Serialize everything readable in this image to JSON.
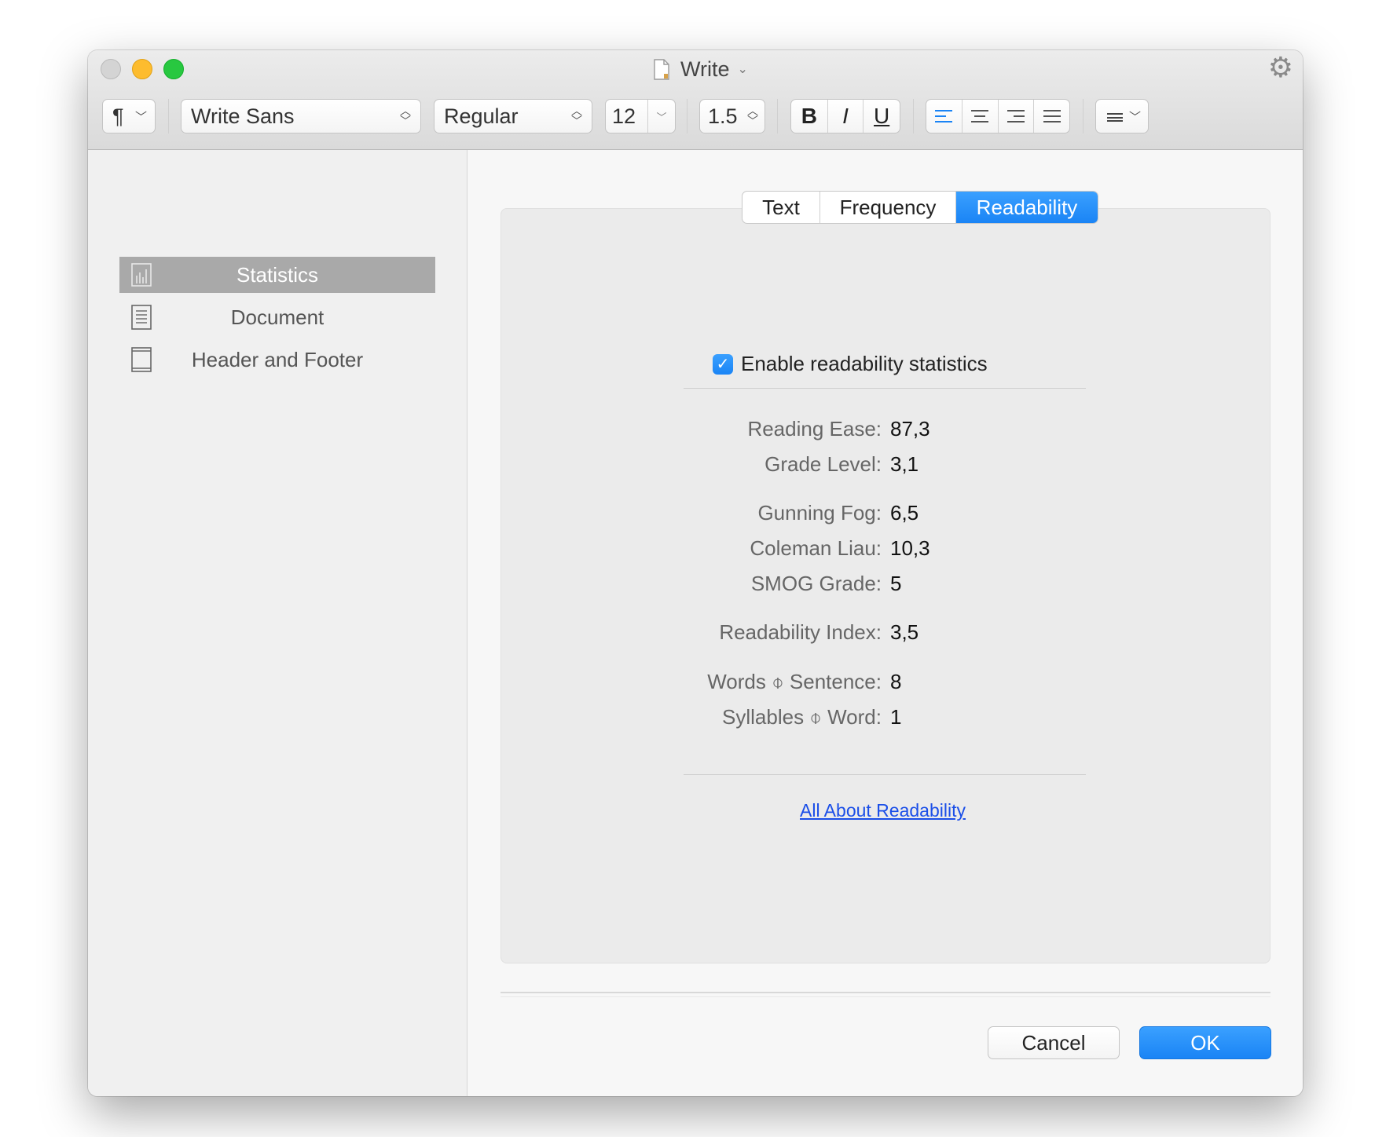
{
  "window": {
    "title": "Write"
  },
  "toolbar": {
    "paragraph_symbol": "¶",
    "font_family": "Write Sans",
    "font_style": "Regular",
    "font_size": "12",
    "line_spacing": "1.5",
    "bold": "B",
    "italic": "I",
    "underline": "U"
  },
  "sidebar": {
    "items": [
      {
        "label": "Statistics",
        "icon": "bar-chart-icon",
        "selected": true
      },
      {
        "label": "Document",
        "icon": "document-icon",
        "selected": false
      },
      {
        "label": "Header and Footer",
        "icon": "page-icon",
        "selected": false
      }
    ]
  },
  "tabs": [
    {
      "label": "Text",
      "active": false
    },
    {
      "label": "Frequency",
      "active": false
    },
    {
      "label": "Readability",
      "active": true
    }
  ],
  "readability": {
    "enable_label": "Enable readability statistics",
    "enabled": true,
    "stats": [
      {
        "label": "Reading Ease:",
        "value": "87,3"
      },
      {
        "label": "Grade Level:",
        "value": "3,1"
      },
      {
        "label": "Gunning Fog:",
        "value": "6,5"
      },
      {
        "label": "Coleman Liau:",
        "value": "10,3"
      },
      {
        "label": "SMOG Grade:",
        "value": "5"
      },
      {
        "label": "Readability Index:",
        "value": "3,5"
      },
      {
        "label": "Words ⌽ Sentence:",
        "value": "8"
      },
      {
        "label": "Syllables ⌽ Word:",
        "value": "1"
      }
    ],
    "link": "All About Readability"
  },
  "buttons": {
    "cancel": "Cancel",
    "ok": "OK"
  },
  "colors": {
    "accent": "#1a84f5",
    "link": "#1a4ee8",
    "selection": "#a9a9a9"
  }
}
